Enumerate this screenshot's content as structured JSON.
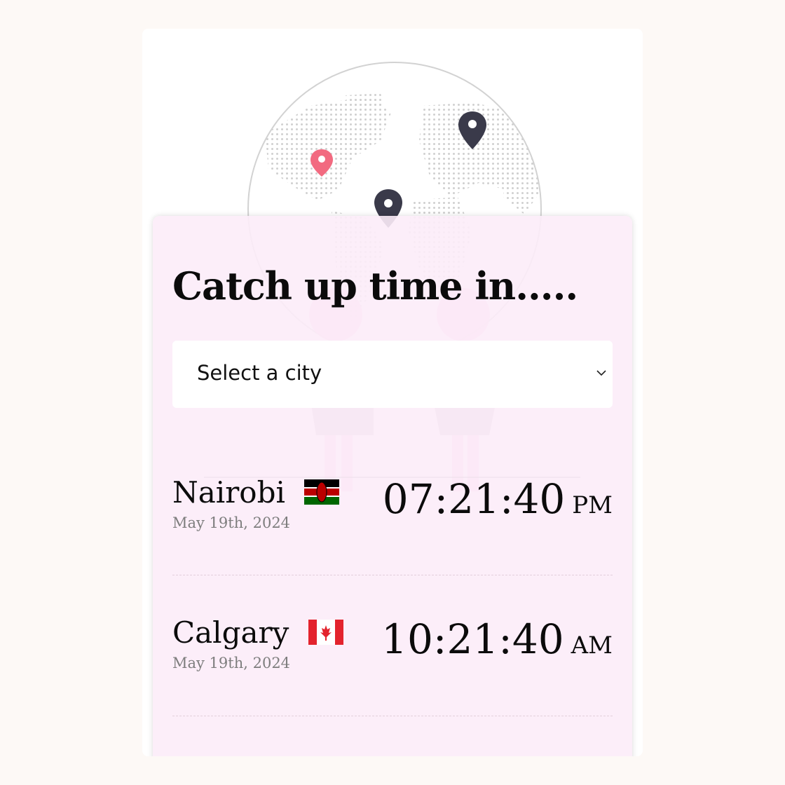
{
  "header": {
    "title": "Catch up time in....."
  },
  "city_select": {
    "selected": "Select a city"
  },
  "clocks": [
    {
      "city": "Nairobi",
      "flag": "kenya-flag-icon",
      "date": "May 19th, 2024",
      "time": "07:21:40",
      "period": "PM"
    },
    {
      "city": "Calgary",
      "flag": "canada-flag-icon",
      "date": "May 19th, 2024",
      "time": "10:21:40",
      "period": "AM"
    }
  ],
  "colors": {
    "background": "#fdf9f6",
    "card": "#fcecf8",
    "pin_accent": "#f26a80",
    "pin_dark": "#3a3a4a"
  }
}
